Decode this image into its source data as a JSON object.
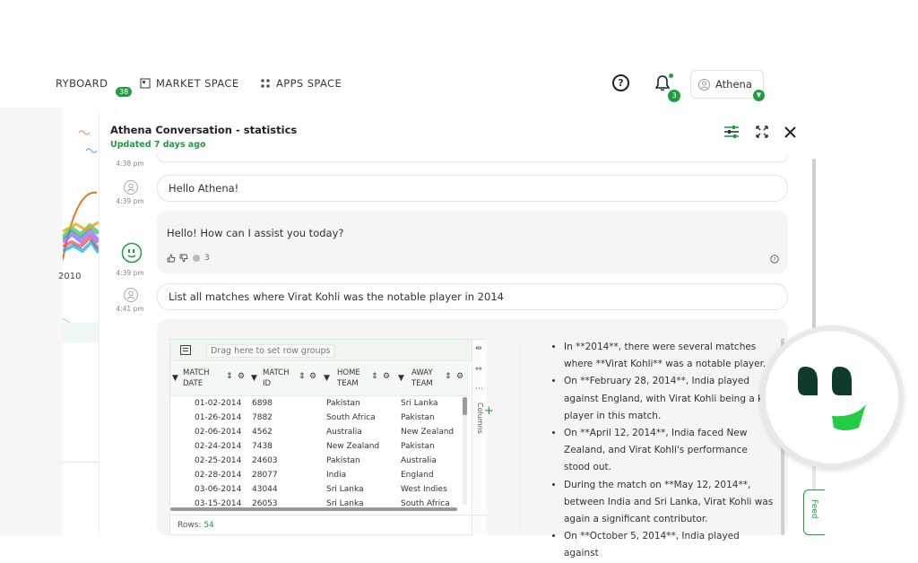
{
  "nav": {
    "storyboard": "RYBOARD",
    "storyboard_badge": "38",
    "market": "MARKET SPACE",
    "apps": "APPS SPACE",
    "help": "?",
    "notif_count": "3",
    "user": "Athena"
  },
  "background": {
    "year_label": "2010"
  },
  "panel": {
    "title": "Athena Conversation - statistics",
    "updated": "Updated 7 days ago"
  },
  "messages": [
    {
      "time": "4:38 pm"
    },
    {
      "time": "4:39 pm",
      "text": "Hello Athena!"
    },
    {
      "time": "4:39 pm",
      "text": "Hello! How can I assist you today?",
      "comment_count": "3"
    },
    {
      "time": "4:41 pm",
      "text": "List all matches where Virat Kohli was the notable player in 2014"
    }
  ],
  "grid": {
    "group_placeholder": "Drag here to set row groups",
    "headers": [
      "MATCH DATE",
      "MATCH ID",
      "HOME TEAM",
      "AWAY TEAM"
    ],
    "side_label": "Columns",
    "rows": [
      [
        "01-02-2014",
        "6898",
        "Pakistan",
        "Sri Lanka"
      ],
      [
        "01-26-2014",
        "7882",
        "South Africa",
        "Pakistan"
      ],
      [
        "02-06-2014",
        "4562",
        "Australia",
        "New Zealand"
      ],
      [
        "02-24-2014",
        "7438",
        "New Zealand",
        "Pakistan"
      ],
      [
        "02-25-2014",
        "24603",
        "Pakistan",
        "Australia"
      ],
      [
        "02-28-2014",
        "28077",
        "India",
        "England"
      ],
      [
        "03-06-2014",
        "43044",
        "Sri Lanka",
        "West Indies"
      ],
      [
        "03-15-2014",
        "26053",
        "Sri Lanka",
        "South Africa"
      ]
    ],
    "rows_label": "Rows:",
    "rows_count": "54"
  },
  "bullets": [
    "In **2014**, there were several matches where **Virat Kohli** was a notable player.",
    "On **February 28, 2014**, India played against England, with Virat Kohli being a key player in this match.",
    "On **April 12, 2014**, India faced New Zealand, and Virat Kohli's performance stood out.",
    "During the match on **May 12, 2014**, between India and Sri Lanka, Virat Kohli was again a significant contributor.",
    "On **October 5, 2014**, India played against"
  ],
  "feedback": "Feed",
  "colors": {
    "brand_green": "#1f9d3f",
    "logo_dark": "#0f3b2c",
    "logo_light": "#22cc44"
  }
}
